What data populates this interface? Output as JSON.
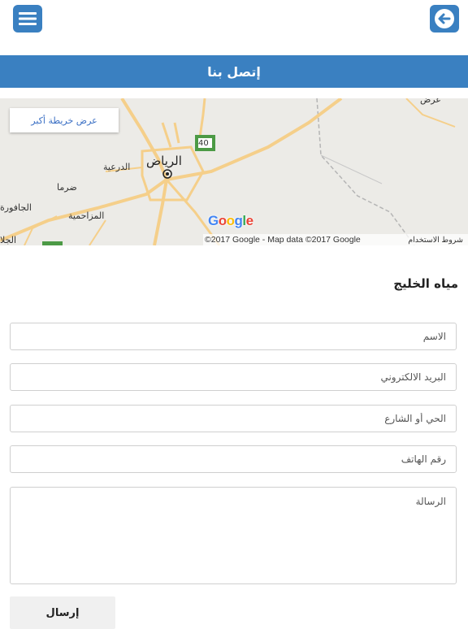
{
  "header": {
    "menu_icon": "hamburger-menu-icon",
    "back_icon": "arrow-left-icon",
    "accent": "#3a80c1",
    "title": "إتصل بنا"
  },
  "map": {
    "larger_map_label": "عرض خريطة أكبر",
    "labels": {
      "riyadh": "الرياض",
      "diriyah": "الدرعية",
      "dirma": "ضرما",
      "muzahimiyah": "المزاحمية",
      "jafurah": "الجافورة",
      "jala": "الجلا",
      "topright": "عرض",
      "road": "40"
    },
    "logo": "Google",
    "attribution": "©2017 Google - Map data ©2017 Google",
    "terms": "شروط الاستخدام"
  },
  "company_name": "مياه الخليج",
  "form": {
    "name_placeholder": "الاسم",
    "email_placeholder": "البريد الالكتروني",
    "address_placeholder": "الحي أو الشارع",
    "phone_placeholder": "رقم الهاتف",
    "message_placeholder": "الرسالة",
    "submit_label": "إرسال"
  }
}
